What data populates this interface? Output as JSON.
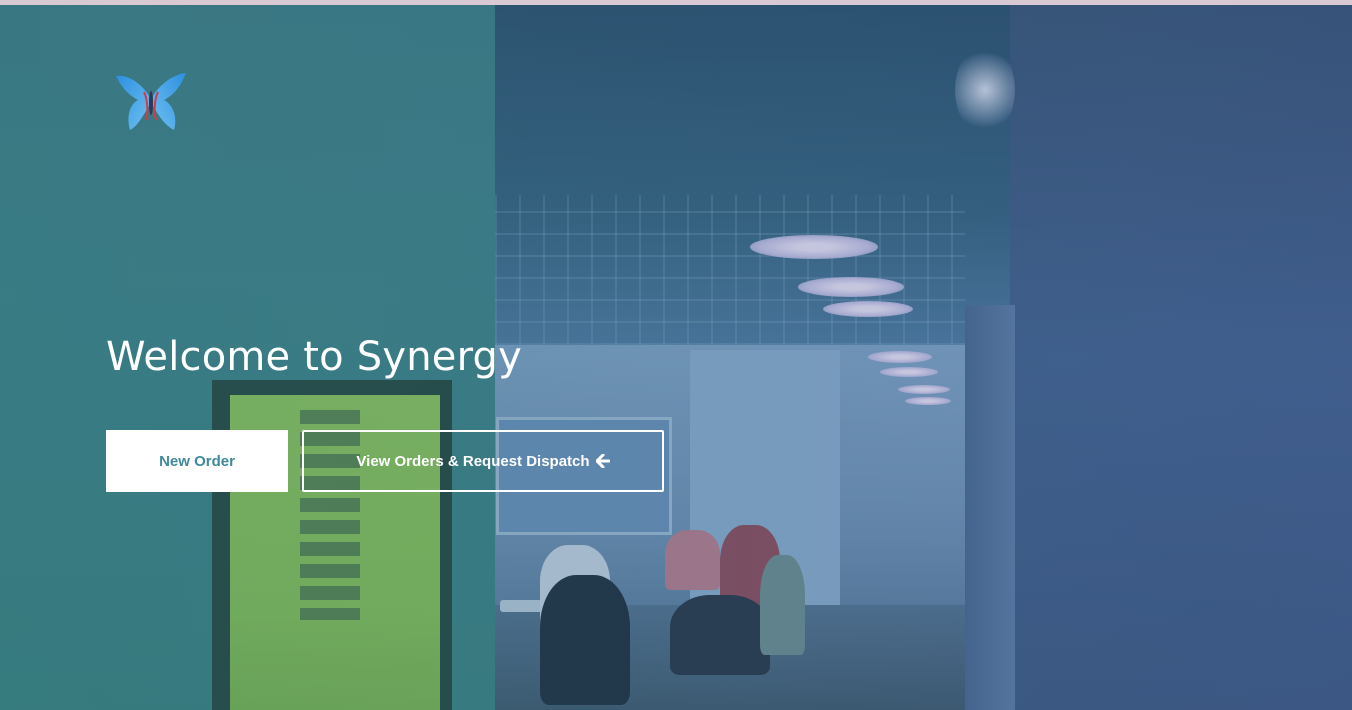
{
  "hero": {
    "title": "Welcome to Synergy",
    "logo_icon": "butterfly-icon"
  },
  "actions": {
    "new_order_label": "New Order",
    "view_orders_label": "View Orders & Request Dispatch",
    "view_orders_icon": "arrow-left-icon"
  },
  "colors": {
    "primary_text": "#3e8a9a",
    "button_bg": "#ffffff",
    "butterfly_blue": "#4aa8e6",
    "butterfly_body": "#d33a4a"
  }
}
